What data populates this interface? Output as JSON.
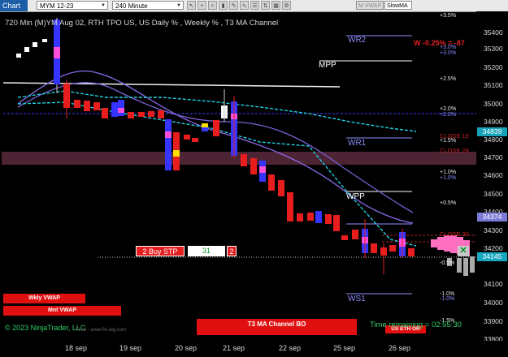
{
  "toolbar": {
    "chart_label": "Chart",
    "instrument": "MYM 12-23",
    "period": "240 Minute",
    "indicators": [
      {
        "label": "M VWAP",
        "active": false
      },
      {
        "label": "SlowMA",
        "active": true
      }
    ]
  },
  "chart": {
    "title": "720 Min (M)YM  Aug 02, RTH TPO US, US Daily % , Weekly % , T3 MA Channel",
    "copyright": "© 2023 NinjaTrader, LLC",
    "source": "Final - www.fin-alg.com",
    "time_remaining": "Time remaining = 02:55:30"
  },
  "price_axis": {
    "labels": [
      "35400",
      "35300",
      "35200",
      "35100",
      "35000",
      "34900",
      "34800",
      "34700",
      "34600",
      "34500",
      "34400",
      "34300",
      "34200",
      "34100",
      "34000",
      "33900",
      "33800"
    ],
    "tags": [
      {
        "text": "34839",
        "color": "#17a3b8",
        "price": 34839
      },
      {
        "text": "34374",
        "color": "#7b7bd6",
        "price": 34374
      },
      {
        "text": "34145",
        "color": "#17a8c0",
        "price": 34145
      }
    ]
  },
  "time_axis": {
    "labels": [
      "18 sep",
      "19 sep",
      "20 sep",
      "21 sep",
      "22 sep",
      "25 sep",
      "26 sep"
    ]
  },
  "levels": {
    "pivots": [
      {
        "label": "WR2",
        "color": "#8f8fff"
      },
      {
        "label": "MPP",
        "color": "#ffffff"
      },
      {
        "label": "WR1",
        "color": "#8f8fff"
      },
      {
        "label": "WPP",
        "color": "#ffffff"
      },
      {
        "label": "WS1",
        "color": "#8f8fff"
      }
    ],
    "percents_white": [
      "+3.5%",
      "+2.5%",
      "+2.0%",
      "+1.5%",
      "+1.0%",
      "+0.5%",
      "-0.5%",
      "-1.0%",
      "-1.5%"
    ],
    "percents_blue": [
      "+3.0%",
      "+3.0%",
      "+2.0%",
      "+1.0%",
      "-1.0%"
    ],
    "closes": [
      "CLOSE 19",
      "CLOSE 28",
      "CLOSE 30"
    ]
  },
  "pnl": "W -0.25% = -87",
  "order": {
    "buy_label": "2  Buy STP",
    "quantity": "31",
    "close_label": "2"
  },
  "buttons": {
    "wkly_vwap": "Wkly VWAP",
    "mnt_vwap": "Mnt VWAP",
    "t3_channel": "T3 MA Channel BO",
    "us_eth": "US ETH OR"
  },
  "close_icon": "close-x-icon",
  "chart_data": {
    "type": "candlestick",
    "ylim": [
      33800,
      35450
    ],
    "x": [
      "18 sep",
      "19 sep",
      "20 sep",
      "21 sep",
      "22 sep",
      "25 sep",
      "26 sep"
    ]
  }
}
